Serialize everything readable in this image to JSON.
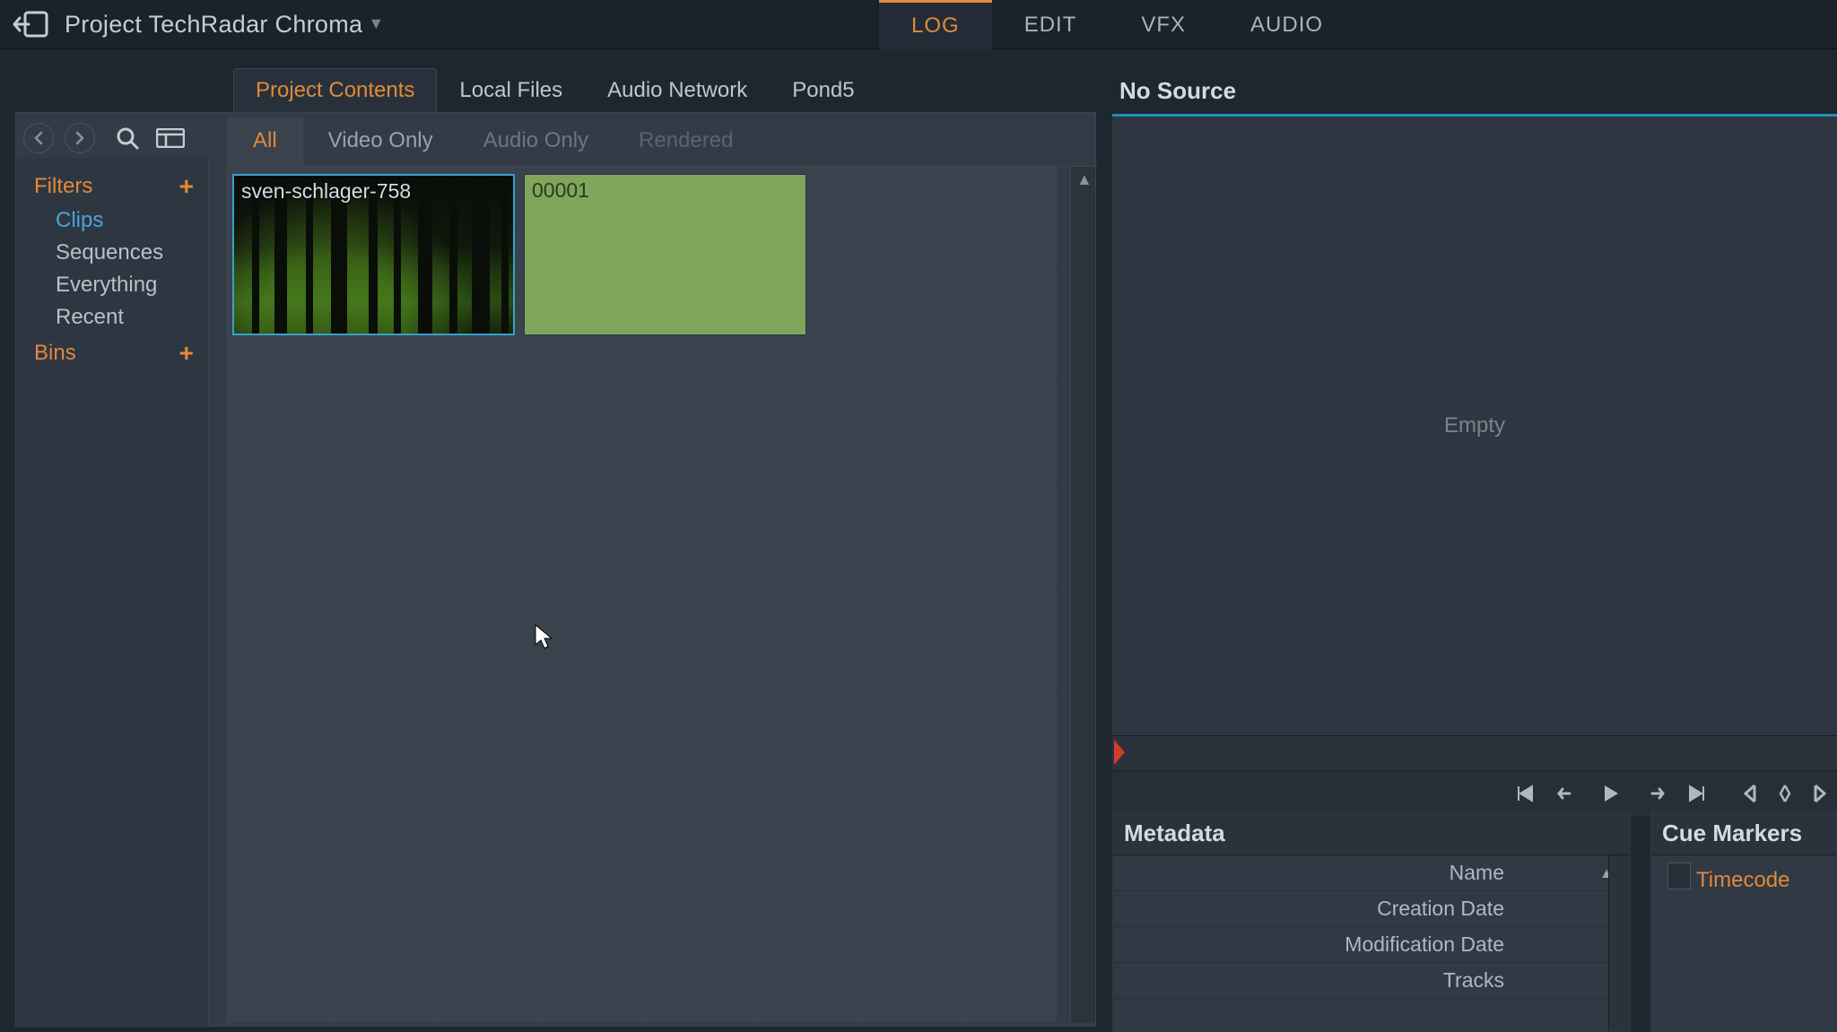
{
  "titlebar": {
    "project_name": "Project TechRadar Chroma"
  },
  "mode_tabs": {
    "log": "LOG",
    "edit": "EDIT",
    "vfx": "VFX",
    "audio": "AUDIO"
  },
  "source_tabs": {
    "project_contents": "Project Contents",
    "local_files": "Local Files",
    "audio_network": "Audio Network",
    "pond5": "Pond5"
  },
  "sidebar": {
    "filters_header": "Filters",
    "bins_header": "Bins",
    "filter_items": {
      "clips": "Clips",
      "sequences": "Sequences",
      "everything": "Everything",
      "recent": "Recent"
    }
  },
  "filter_tabs": {
    "all": "All",
    "video_only": "Video Only",
    "audio_only": "Audio Only",
    "rendered": "Rendered"
  },
  "clips": {
    "forest": "sven-schlager-758",
    "green": "00001"
  },
  "viewer": {
    "title": "No Source",
    "empty_label": "Empty"
  },
  "metadata": {
    "header": "Metadata",
    "fields": {
      "name": "Name",
      "creation_date": "Creation Date",
      "modification_date": "Modification Date",
      "tracks": "Tracks"
    }
  },
  "cue_markers": {
    "header": "Cue Markers",
    "timecode_col": "Timecode"
  }
}
